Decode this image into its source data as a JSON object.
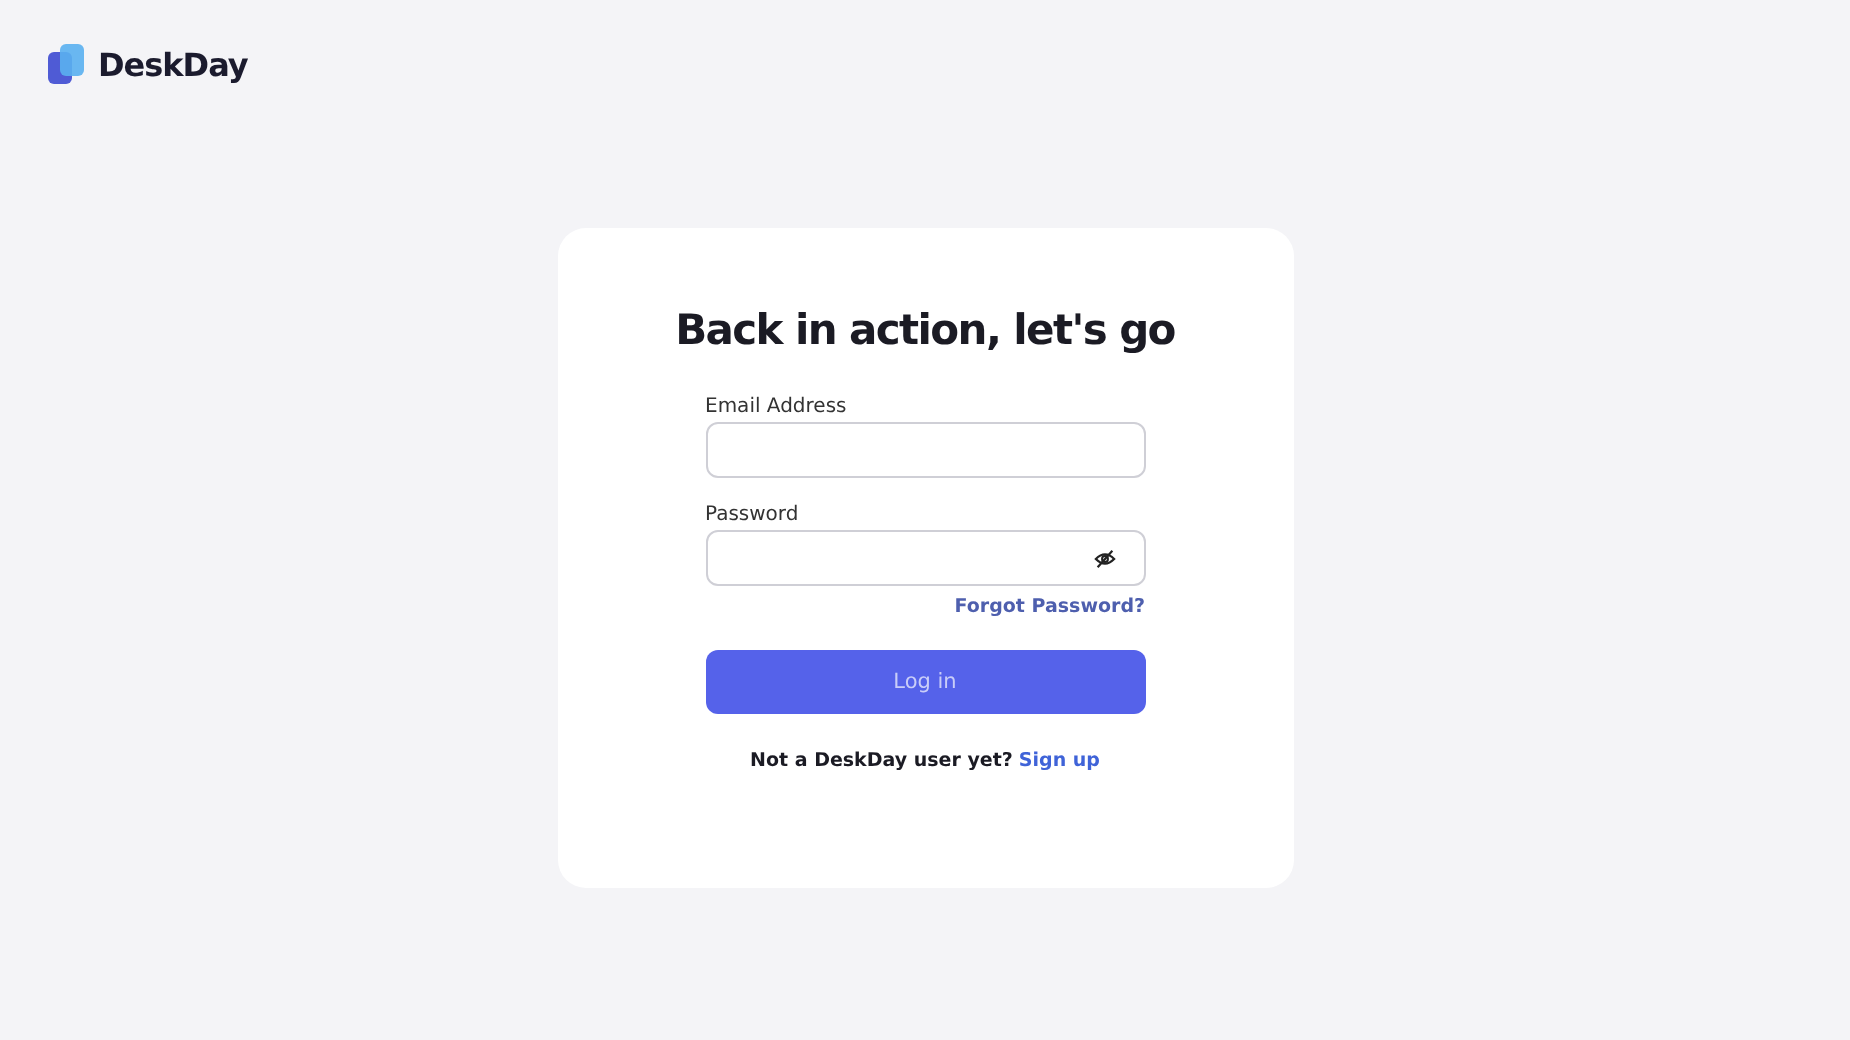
{
  "brand": {
    "name": "DeskDay"
  },
  "card": {
    "title": "Back in action, let's go",
    "fields": [
      {
        "label": "Email Address",
        "kind": "text"
      },
      {
        "label": "Password",
        "kind": "password"
      }
    ],
    "forgot_link": "Forgot Password?",
    "login_button": "Log in",
    "signup_prompt": "Not a DeskDay user yet?",
    "signup_link": "Sign up"
  }
}
